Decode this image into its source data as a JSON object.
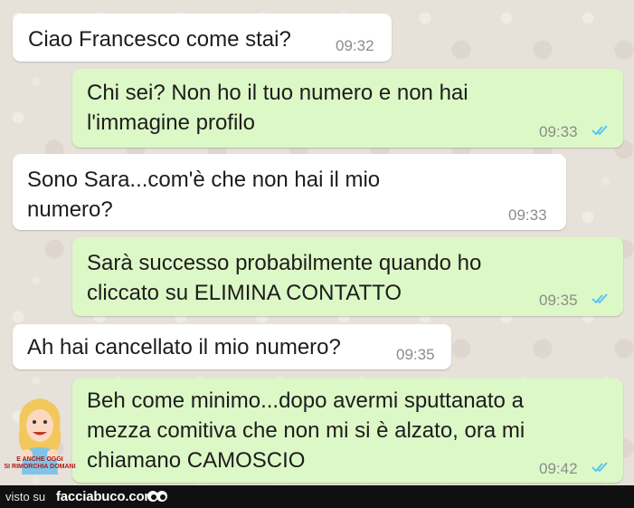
{
  "messages": [
    {
      "side": "in",
      "text": "Ciao Francesco come stai?",
      "time": "09:32"
    },
    {
      "side": "out",
      "text": "Chi sei? Non ho il tuo numero e non hai\nl'immagine profilo",
      "time": "09:33",
      "read": true
    },
    {
      "side": "in",
      "text": "Sono Sara...com'è che non hai il mio\nnumero?",
      "time": "09:33"
    },
    {
      "side": "out",
      "text": "Sarà successo probabilmente quando ho\ncliccato su ELIMINA CONTATTO",
      "time": "09:35",
      "read": true
    },
    {
      "side": "in",
      "text": "Ah hai cancellato il mio numero?",
      "time": "09:35"
    },
    {
      "side": "out",
      "text": "Beh come minimo...dopo avermi sputtanato a\nmezza comitiva che non mi si è alzato, ora mi\nchiamano CAMOSCIO",
      "time": "09:42",
      "read": true
    }
  ],
  "sticker": {
    "caption": "E ANCHE OGGI\nSI RIMORCHIA DOMANI"
  },
  "footer": {
    "visto_su": "visto su",
    "site": "facciabuco.com"
  },
  "colors": {
    "incoming": "#ffffff",
    "outgoing": "#dcf8c6",
    "read_ticks": "#4fc3f7"
  }
}
